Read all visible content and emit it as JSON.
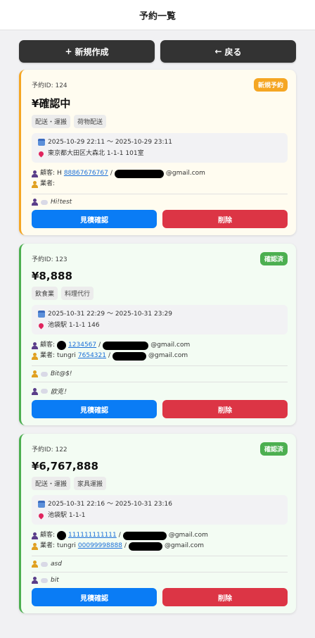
{
  "header": {
    "title": "予約一覧"
  },
  "actions": {
    "new_label": "新規作成",
    "new_icon": "+",
    "back_label": "戻る",
    "back_icon": "←"
  },
  "labels": {
    "id_prefix": "予約ID: ",
    "customer": "顧客: ",
    "vendor": "業者: ",
    "quote_button": "見積確認",
    "delete_button": "削除"
  },
  "colors": {
    "pending": "#f5a623",
    "confirmed": "#4caf50",
    "quote": "#0a7cf5",
    "delete": "#dc3545"
  },
  "orders": [
    {
      "id": "予約ID: 124",
      "badge": "新規予約",
      "status": "pending",
      "price": "¥確認中",
      "tags": [
        "配送・運搬",
        "荷物配送"
      ],
      "datetime": "2025-10-29 22:11 〜 2025-10-29 23:11",
      "address": "東京都大田区大森北 1-1-1 101室",
      "customer": {
        "name": "H ",
        "phone": "88867676767",
        "sep": " / ",
        "email_suffix": "@gmail.com"
      },
      "vendor": {
        "name": "",
        "phone": "",
        "email_suffix": ""
      },
      "messages": [
        {
          "who": "customer",
          "text": "Hi!test"
        }
      ]
    },
    {
      "id": "予約ID: 123",
      "badge": "確認済",
      "status": "confirmed",
      "price": "¥8,888",
      "tags": [
        "飲食業",
        "料理代行"
      ],
      "datetime": "2025-10-31 22:29 〜 2025-10-31 23:29",
      "address": "池袋駅 1-1-1 146",
      "customer": {
        "name": "",
        "phone": "1234567",
        "sep": " / ",
        "email_suffix": "@gmail.com"
      },
      "vendor": {
        "name": "tungri ",
        "phone": "7654321",
        "sep": " / ",
        "email_suffix": "@gmail.com"
      },
      "messages": [
        {
          "who": "vendor",
          "text": "Bit@$!"
        },
        {
          "who": "customer",
          "text": "欧克！"
        }
      ]
    },
    {
      "id": "予約ID: 122",
      "badge": "確認済",
      "status": "confirmed",
      "price": "¥6,767,888",
      "tags": [
        "配送・運搬",
        "家具運搬"
      ],
      "datetime": "2025-10-31 22:16 〜 2025-10-31 23:16",
      "address": "池袋駅 1-1-1",
      "customer": {
        "name": "",
        "phone": "111111111111",
        "sep": " / ",
        "email_suffix": "@gmail.com"
      },
      "vendor": {
        "name": "tungri ",
        "phone": "00099998888",
        "sep": " / ",
        "email_suffix": "@gmail.com"
      },
      "messages": [
        {
          "who": "vendor",
          "text": "asd"
        },
        {
          "who": "customer",
          "text": "bit"
        }
      ]
    }
  ]
}
